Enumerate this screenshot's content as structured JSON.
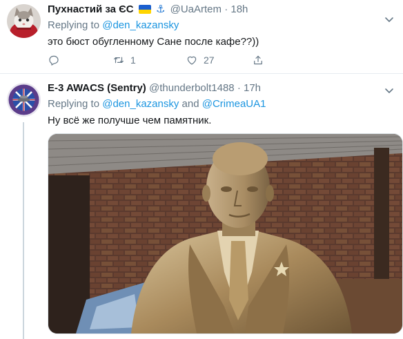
{
  "tweets": [
    {
      "name": "Пухнастий за ЄС",
      "handle": "@UaArtem",
      "separator": "·",
      "time": "18h",
      "replying_label": "Replying to",
      "mentions": [
        "@den_kazansky"
      ],
      "text": "это бюст обугленному Сане после кафе??))",
      "retweets": "1",
      "likes": "27",
      "icons": [
        "flag-ukraine-icon",
        "anchor-icon",
        "reply-icon",
        "retweet-icon",
        "like-icon",
        "share-icon",
        "chevron-down-icon"
      ]
    },
    {
      "name": "E-3 AWACS (Sentry)",
      "handle": "@thunderbolt1488",
      "separator": "·",
      "time": "17h",
      "replying_label": "Replying to",
      "mentions": [
        "@den_kazansky",
        "@CrimeaUA1"
      ],
      "mention_joiner": "and",
      "text": "Ну всё же получше чем памятник.",
      "image_alt": "bronze bust statue in front of a brick wall",
      "icons": [
        "chevron-down-icon"
      ]
    }
  ],
  "colors": {
    "link": "#1b95e0",
    "secondary_text": "#657786",
    "primary_text": "#14171a",
    "divider": "#e6ecf0"
  }
}
